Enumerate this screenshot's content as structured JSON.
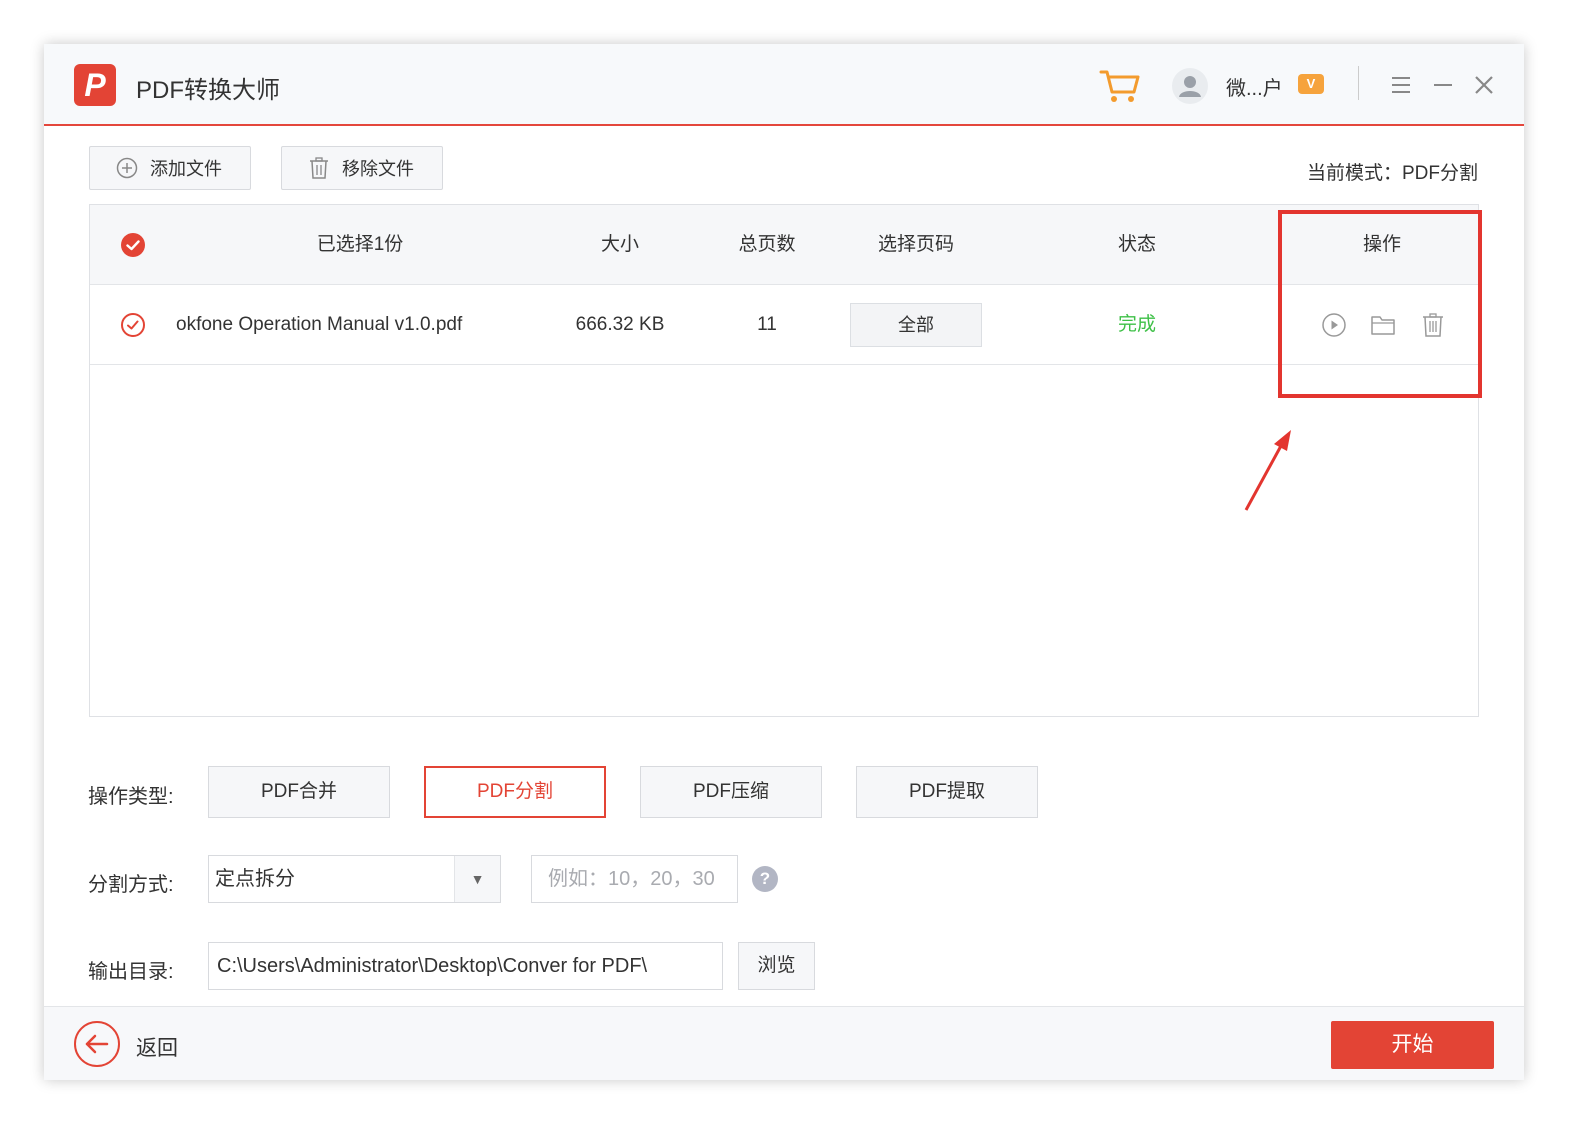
{
  "app": {
    "title": "PDF转换大师",
    "logo_letter": "P",
    "user_name": "微...户",
    "vip_badge": "V"
  },
  "toolbar": {
    "add_label": "添加文件",
    "remove_label": "移除文件",
    "mode_text": "当前模式：PDF分割"
  },
  "table": {
    "headers": {
      "select": "已选择1份",
      "size": "大小",
      "pages": "总页数",
      "page_select": "选择页码",
      "status": "状态",
      "actions": "操作"
    },
    "rows": [
      {
        "name": "okfone Operation Manual v1.0.pdf",
        "size": "666.32 KB",
        "pages": "11",
        "page_select": "全部",
        "status": "完成"
      }
    ]
  },
  "options": {
    "type_label": "操作类型:",
    "types": [
      "PDF合并",
      "PDF分割",
      "PDF压缩",
      "PDF提取"
    ],
    "active_type": "PDF分割",
    "split_label": "分割方式:",
    "split_value": "定点拆分",
    "pages_placeholder": "例如：10，20，30",
    "help": "?",
    "output_label": "输出目录:",
    "output_path": "C:\\Users\\Administrator\\Desktop\\Conver for PDF\\",
    "browse_label": "浏览"
  },
  "footer": {
    "back_label": "返回",
    "start_label": "开始"
  },
  "colors": {
    "accent": "#e34435",
    "success": "#3ec047",
    "annotation": "#e3352f"
  }
}
